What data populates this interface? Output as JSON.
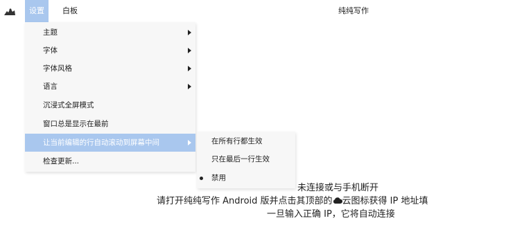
{
  "menubar": {
    "settings_label": "设置",
    "whiteboard_label": "白板",
    "window_title": "纯纯写作"
  },
  "settings_menu": {
    "items": [
      {
        "label": "主题",
        "has_submenu": true
      },
      {
        "label": "字体",
        "has_submenu": true
      },
      {
        "label": "字体风格",
        "has_submenu": true
      },
      {
        "label": "语言",
        "has_submenu": true
      },
      {
        "label": "沉浸式全屏模式",
        "has_submenu": false
      },
      {
        "label": "窗口总是显示在最前",
        "has_submenu": false
      },
      {
        "label": "让当前编辑的行自动滚动到屏幕中间",
        "has_submenu": true,
        "active": true
      },
      {
        "label": "检查更新...",
        "has_submenu": false
      }
    ]
  },
  "scroll_submenu": {
    "options": [
      {
        "label": "在所有行都生效",
        "selected": false
      },
      {
        "label": "只在最后一行生效",
        "selected": false
      },
      {
        "label": "禁用",
        "selected": true
      }
    ]
  },
  "status": {
    "line1": "未连接或与手机断开",
    "line2_before": "请打开纯纯写作 Android 版并点击其顶部的",
    "line2_after": "云图标获得 IP 地址填",
    "line3": "一旦输入正确 IP，它将自动连接"
  },
  "colors": {
    "highlight": "#a9c7ee",
    "menu_bg": "#f7f7f7"
  },
  "icons": {
    "app": "app-logo-icon",
    "cloud": "cloud-icon"
  }
}
